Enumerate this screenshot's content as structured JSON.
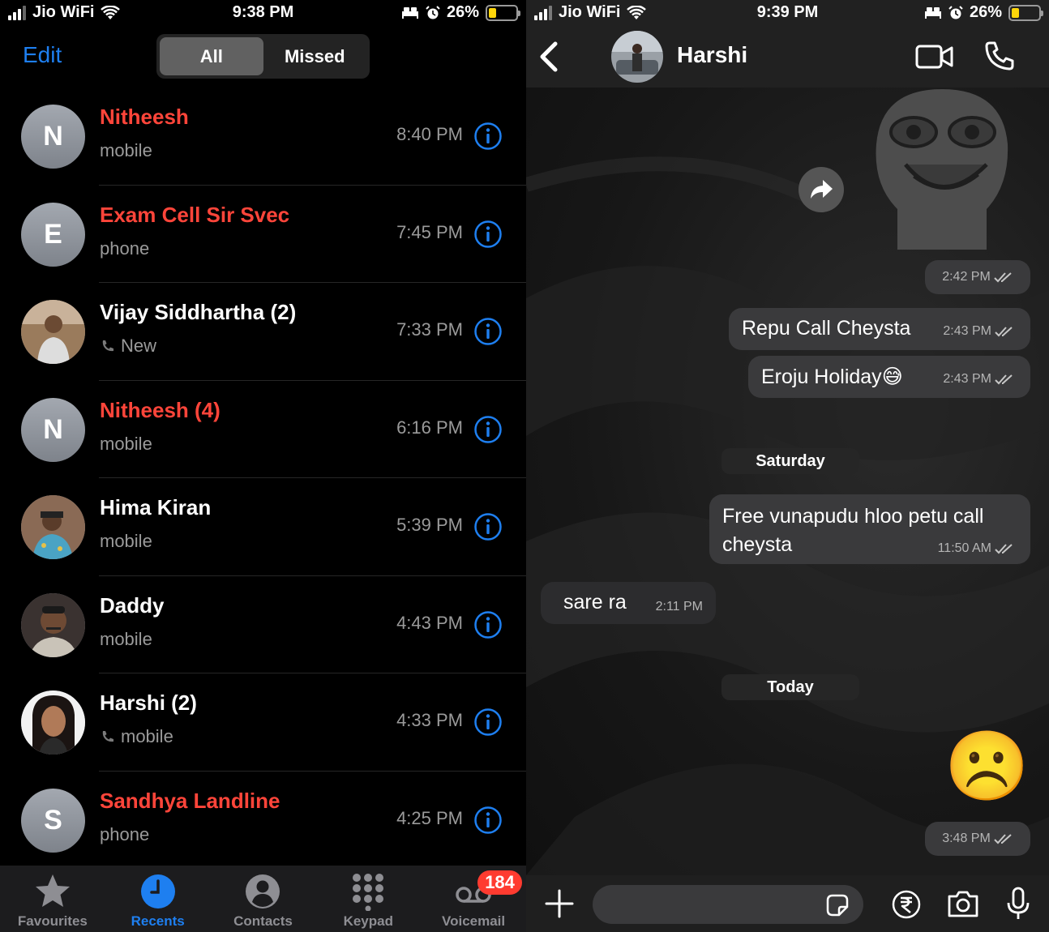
{
  "left": {
    "status": {
      "carrier": "Jio WiFi",
      "time": "9:38 PM",
      "battery": "26%"
    },
    "edit_label": "Edit",
    "segments": [
      "All",
      "Missed"
    ],
    "calls": [
      {
        "initial": "N",
        "name": "Nitheesh",
        "type": "mobile",
        "time": "8:40 PM",
        "missed": true
      },
      {
        "initial": "E",
        "name": "Exam Cell Sir Svec",
        "type": "phone",
        "time": "7:45 PM",
        "missed": true
      },
      {
        "initial": "",
        "name": "Vijay Siddhartha (2)",
        "type": "New",
        "time": "7:33 PM",
        "missed": false,
        "phone_icon": true
      },
      {
        "initial": "N",
        "name": "Nitheesh (4)",
        "type": "mobile",
        "time": "6:16 PM",
        "missed": true
      },
      {
        "initial": "",
        "name": "Hima Kiran",
        "type": "mobile",
        "time": "5:39 PM",
        "missed": false
      },
      {
        "initial": "",
        "name": "Daddy",
        "type": "mobile",
        "time": "4:43 PM",
        "missed": false
      },
      {
        "initial": "",
        "name": "Harshi (2)",
        "type": "mobile",
        "time": "4:33 PM",
        "missed": false,
        "phone_icon": true
      },
      {
        "initial": "S",
        "name": "Sandhya Landline",
        "type": "phone",
        "time": "4:25 PM",
        "missed": true
      }
    ],
    "tabs": [
      {
        "label": "Favourites",
        "icon": "star-icon"
      },
      {
        "label": "Recents",
        "icon": "clock-icon",
        "active": true
      },
      {
        "label": "Contacts",
        "icon": "person-icon"
      },
      {
        "label": "Keypad",
        "icon": "keypad-icon"
      },
      {
        "label": "Voicemail",
        "icon": "voicemail-icon",
        "badge": "184"
      }
    ],
    "colors": {
      "accent": "#1e7ff0",
      "missed": "#ff453a",
      "badge": "#ff3b30"
    }
  },
  "right": {
    "status": {
      "carrier": "Jio WiFi",
      "time": "9:39 PM",
      "battery": "26%"
    },
    "contact_name": "Harshi",
    "messages": {
      "sticker_time": "2:42 PM",
      "m1": {
        "text": "Repu Call Cheysta",
        "time": "2:43 PM"
      },
      "m2": {
        "text": "Eroju Holiday",
        "emoji": "😅",
        "time": "2:43 PM"
      },
      "day1": "Saturday",
      "m3": {
        "text": "Free vunapudu hloo petu call cheysta",
        "time": "11:50 AM"
      },
      "m4": {
        "text": "sare ra",
        "time": "2:11 PM"
      },
      "day2": "Today",
      "m5": {
        "emoji": "☹️",
        "time": "3:48 PM"
      }
    }
  }
}
